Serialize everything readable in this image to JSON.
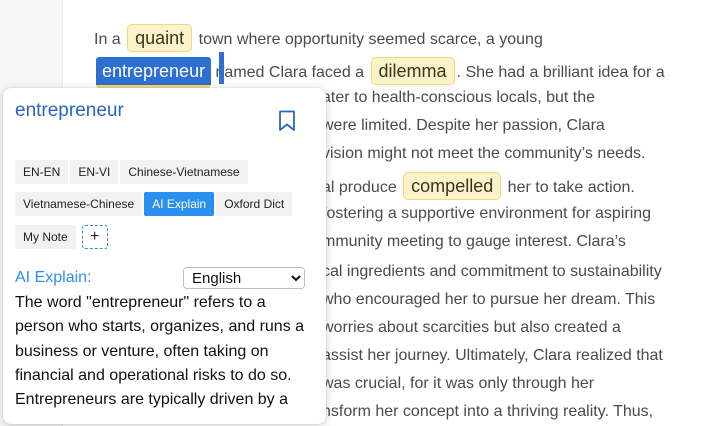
{
  "article": {
    "lines": [
      {
        "pre": "In a",
        "hl": "quaint",
        "post": "town where opportunity seemed scarce, a young"
      },
      {
        "sel": "entrepreneur",
        "post": "named Clara faced a",
        "hl": "dilemma",
        "post2": ". She had a brilliant idea for a"
      },
      {
        "text": "ater to health-conscious locals, but the"
      },
      {
        "text": "were limited. Despite her passion, Clara"
      },
      {
        "text": "vision might not meet the community’s needs."
      },
      {
        "pre": "al produce",
        "hl": "compelled",
        "post": "her to take action."
      },
      {
        "text": "fostering a supportive environment for aspiring"
      },
      {
        "text": "mmunity meeting to gauge interest. Clara’s"
      },
      {
        "text": "cal ingredients and commitment to sustainability"
      },
      {
        "text": "who encouraged her to pursue her dream. This"
      },
      {
        "text": "worries about scarcities but also created a"
      },
      {
        "text": "assist her journey. Ultimately, Clara realized that"
      },
      {
        "text": "was crucial, for it was only through her"
      },
      {
        "text": "nsform her concept into a thriving reality. Thus,"
      }
    ]
  },
  "popup": {
    "word": "entrepreneur",
    "bookmark_icon": "bookmark-icon",
    "tabs_row1": [
      "EN-EN",
      "EN-VI",
      "Chinese-Vietnamese"
    ],
    "tabs_row2": [
      "Vietnamese-Chinese",
      "AI Explain",
      "Oxford Dict"
    ],
    "tabs_row3": [
      "My Note"
    ],
    "active_tab": "AI Explain",
    "add_tab_label": "+",
    "section_label": "AI Explain:",
    "language": {
      "selected": "English",
      "options": [
        "English"
      ]
    },
    "explanation": "The word \"entrepreneur\" refers to a person who starts, organizes, and runs a business or venture, often taking on financial and operational risks to do so. Entrepreneurs are typically driven by a"
  },
  "colors": {
    "highlight_bg": "#fdf3c8",
    "highlight_border": "#f3d77a",
    "selection": "#2f6fd1",
    "accent": "#2b8ff0",
    "title": "#2a64c2"
  }
}
